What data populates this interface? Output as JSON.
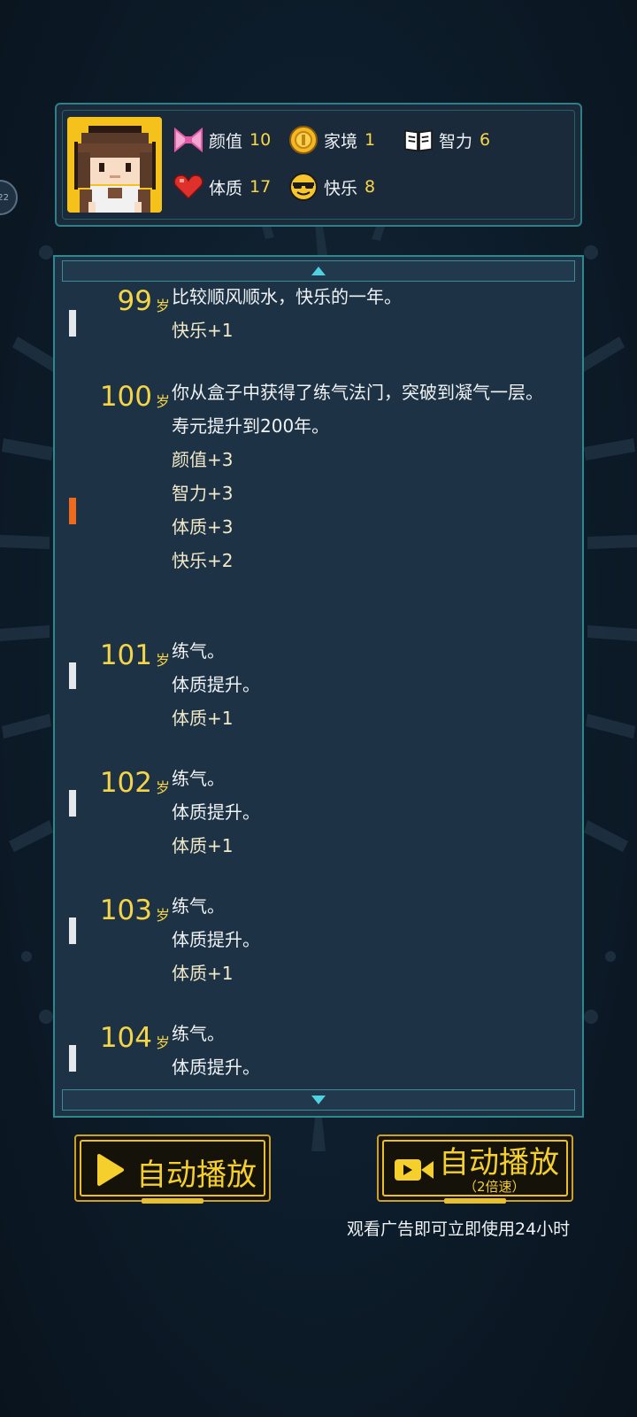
{
  "stats": [
    {
      "label": "颜值",
      "value": "10",
      "icon": "bow-icon"
    },
    {
      "label": "家境",
      "value": "1",
      "icon": "coin-icon"
    },
    {
      "label": "智力",
      "value": "6",
      "icon": "book-icon"
    },
    {
      "label": "体质",
      "value": "17",
      "icon": "heart-icon"
    },
    {
      "label": "快乐",
      "value": "8",
      "icon": "sunglasses-face-icon"
    }
  ],
  "side_bubble_text": "22",
  "age_unit": "岁",
  "log": [
    {
      "age": "99",
      "lines": [
        "比较顺风顺水，快乐的一年。"
      ],
      "effects": [
        "快乐+1"
      ],
      "marker": "white"
    },
    {
      "age": "100",
      "lines": [
        "你从盒子中获得了练气法门，突破到凝气一层。",
        "寿元提升到200年。"
      ],
      "effects": [
        "颜值+3",
        "智力+3",
        "体质+3",
        "快乐+2"
      ],
      "marker": "orange"
    },
    {
      "age": "101",
      "lines": [
        "练气。",
        "体质提升。"
      ],
      "effects": [
        "体质+1"
      ],
      "marker": "white"
    },
    {
      "age": "102",
      "lines": [
        "练气。",
        "体质提升。"
      ],
      "effects": [
        "体质+1"
      ],
      "marker": "white"
    },
    {
      "age": "103",
      "lines": [
        "练气。",
        "体质提升。"
      ],
      "effects": [
        "体质+1"
      ],
      "marker": "white"
    },
    {
      "age": "104",
      "lines": [
        "练气。",
        "体质提升。"
      ],
      "effects": [],
      "marker": "white"
    }
  ],
  "buttons": {
    "autoplay_label": "自动播放",
    "autoplay_fast_label": "自动播放",
    "autoplay_fast_sub": "（2倍速）",
    "ad_note": "观看广告即可立即使用24小时"
  },
  "colors": {
    "accent_yellow": "#f5d548",
    "panel_border": "#2c8a8e",
    "highlight_marker": "#ee6a1e"
  }
}
